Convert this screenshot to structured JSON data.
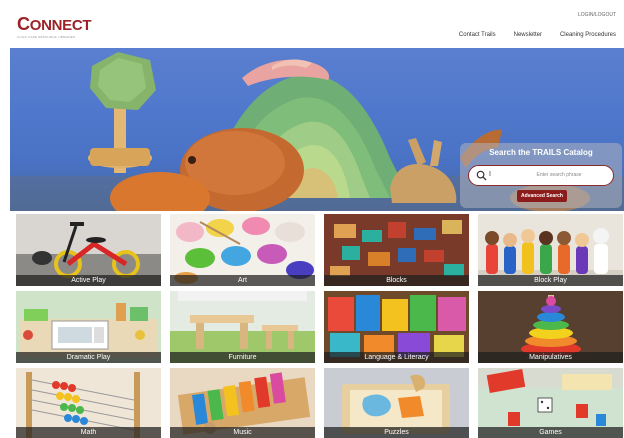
{
  "header": {
    "logo_text_first": "C",
    "logo_text_rest": "ONNECT",
    "logo_subtitle": "CHILD CARE RESOURCE LIBRARIES",
    "logout_label": "LOGIN/LOGOUT",
    "nav": [
      {
        "label": "Contact Trails"
      },
      {
        "label": "Newsletter"
      },
      {
        "label": "Cleaning Procedures"
      }
    ]
  },
  "search": {
    "title": "Search the TRAILS Catalog",
    "input_value": "I",
    "placeholder": "Enter search phrase",
    "advanced_label": "Advanced Search"
  },
  "categories": [
    {
      "label": "Active Play"
    },
    {
      "label": "Art"
    },
    {
      "label": "Blocks"
    },
    {
      "label": "Block Play"
    },
    {
      "label": "Dramatic Play"
    },
    {
      "label": "Furniture"
    },
    {
      "label": "Language & Literacy"
    },
    {
      "label": "Manipulatives"
    },
    {
      "label": "Math"
    },
    {
      "label": "Music"
    },
    {
      "label": "Puzzles"
    },
    {
      "label": "Games"
    }
  ],
  "colors": {
    "brand": "#9b2226",
    "button": "#8c1c1c",
    "label_bg": "#1e1e1e"
  }
}
